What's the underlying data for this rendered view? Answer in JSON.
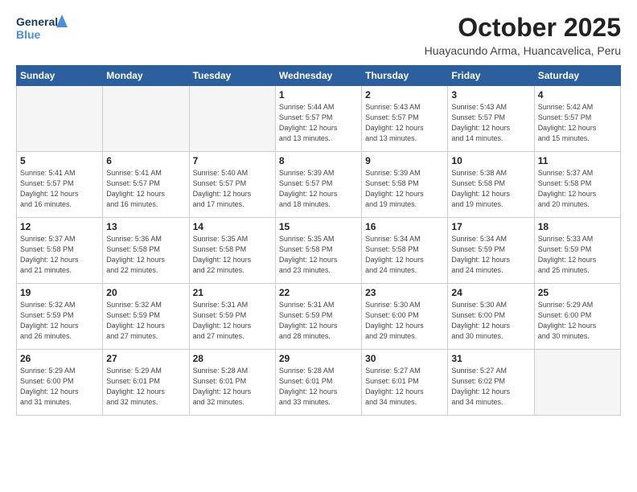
{
  "header": {
    "logo_line1": "General",
    "logo_line2": "Blue",
    "month": "October 2025",
    "location": "Huayacundo Arma, Huancavelica, Peru"
  },
  "weekdays": [
    "Sunday",
    "Monday",
    "Tuesday",
    "Wednesday",
    "Thursday",
    "Friday",
    "Saturday"
  ],
  "weeks": [
    [
      {
        "day": "",
        "info": ""
      },
      {
        "day": "",
        "info": ""
      },
      {
        "day": "",
        "info": ""
      },
      {
        "day": "1",
        "info": "Sunrise: 5:44 AM\nSunset: 5:57 PM\nDaylight: 12 hours\nand 13 minutes."
      },
      {
        "day": "2",
        "info": "Sunrise: 5:43 AM\nSunset: 5:57 PM\nDaylight: 12 hours\nand 13 minutes."
      },
      {
        "day": "3",
        "info": "Sunrise: 5:43 AM\nSunset: 5:57 PM\nDaylight: 12 hours\nand 14 minutes."
      },
      {
        "day": "4",
        "info": "Sunrise: 5:42 AM\nSunset: 5:57 PM\nDaylight: 12 hours\nand 15 minutes."
      }
    ],
    [
      {
        "day": "5",
        "info": "Sunrise: 5:41 AM\nSunset: 5:57 PM\nDaylight: 12 hours\nand 16 minutes."
      },
      {
        "day": "6",
        "info": "Sunrise: 5:41 AM\nSunset: 5:57 PM\nDaylight: 12 hours\nand 16 minutes."
      },
      {
        "day": "7",
        "info": "Sunrise: 5:40 AM\nSunset: 5:57 PM\nDaylight: 12 hours\nand 17 minutes."
      },
      {
        "day": "8",
        "info": "Sunrise: 5:39 AM\nSunset: 5:57 PM\nDaylight: 12 hours\nand 18 minutes."
      },
      {
        "day": "9",
        "info": "Sunrise: 5:39 AM\nSunset: 5:58 PM\nDaylight: 12 hours\nand 19 minutes."
      },
      {
        "day": "10",
        "info": "Sunrise: 5:38 AM\nSunset: 5:58 PM\nDaylight: 12 hours\nand 19 minutes."
      },
      {
        "day": "11",
        "info": "Sunrise: 5:37 AM\nSunset: 5:58 PM\nDaylight: 12 hours\nand 20 minutes."
      }
    ],
    [
      {
        "day": "12",
        "info": "Sunrise: 5:37 AM\nSunset: 5:58 PM\nDaylight: 12 hours\nand 21 minutes."
      },
      {
        "day": "13",
        "info": "Sunrise: 5:36 AM\nSunset: 5:58 PM\nDaylight: 12 hours\nand 22 minutes."
      },
      {
        "day": "14",
        "info": "Sunrise: 5:35 AM\nSunset: 5:58 PM\nDaylight: 12 hours\nand 22 minutes."
      },
      {
        "day": "15",
        "info": "Sunrise: 5:35 AM\nSunset: 5:58 PM\nDaylight: 12 hours\nand 23 minutes."
      },
      {
        "day": "16",
        "info": "Sunrise: 5:34 AM\nSunset: 5:58 PM\nDaylight: 12 hours\nand 24 minutes."
      },
      {
        "day": "17",
        "info": "Sunrise: 5:34 AM\nSunset: 5:59 PM\nDaylight: 12 hours\nand 24 minutes."
      },
      {
        "day": "18",
        "info": "Sunrise: 5:33 AM\nSunset: 5:59 PM\nDaylight: 12 hours\nand 25 minutes."
      }
    ],
    [
      {
        "day": "19",
        "info": "Sunrise: 5:32 AM\nSunset: 5:59 PM\nDaylight: 12 hours\nand 26 minutes."
      },
      {
        "day": "20",
        "info": "Sunrise: 5:32 AM\nSunset: 5:59 PM\nDaylight: 12 hours\nand 27 minutes."
      },
      {
        "day": "21",
        "info": "Sunrise: 5:31 AM\nSunset: 5:59 PM\nDaylight: 12 hours\nand 27 minutes."
      },
      {
        "day": "22",
        "info": "Sunrise: 5:31 AM\nSunset: 5:59 PM\nDaylight: 12 hours\nand 28 minutes."
      },
      {
        "day": "23",
        "info": "Sunrise: 5:30 AM\nSunset: 6:00 PM\nDaylight: 12 hours\nand 29 minutes."
      },
      {
        "day": "24",
        "info": "Sunrise: 5:30 AM\nSunset: 6:00 PM\nDaylight: 12 hours\nand 30 minutes."
      },
      {
        "day": "25",
        "info": "Sunrise: 5:29 AM\nSunset: 6:00 PM\nDaylight: 12 hours\nand 30 minutes."
      }
    ],
    [
      {
        "day": "26",
        "info": "Sunrise: 5:29 AM\nSunset: 6:00 PM\nDaylight: 12 hours\nand 31 minutes."
      },
      {
        "day": "27",
        "info": "Sunrise: 5:29 AM\nSunset: 6:01 PM\nDaylight: 12 hours\nand 32 minutes."
      },
      {
        "day": "28",
        "info": "Sunrise: 5:28 AM\nSunset: 6:01 PM\nDaylight: 12 hours\nand 32 minutes."
      },
      {
        "day": "29",
        "info": "Sunrise: 5:28 AM\nSunset: 6:01 PM\nDaylight: 12 hours\nand 33 minutes."
      },
      {
        "day": "30",
        "info": "Sunrise: 5:27 AM\nSunset: 6:01 PM\nDaylight: 12 hours\nand 34 minutes."
      },
      {
        "day": "31",
        "info": "Sunrise: 5:27 AM\nSunset: 6:02 PM\nDaylight: 12 hours\nand 34 minutes."
      },
      {
        "day": "",
        "info": ""
      }
    ]
  ]
}
